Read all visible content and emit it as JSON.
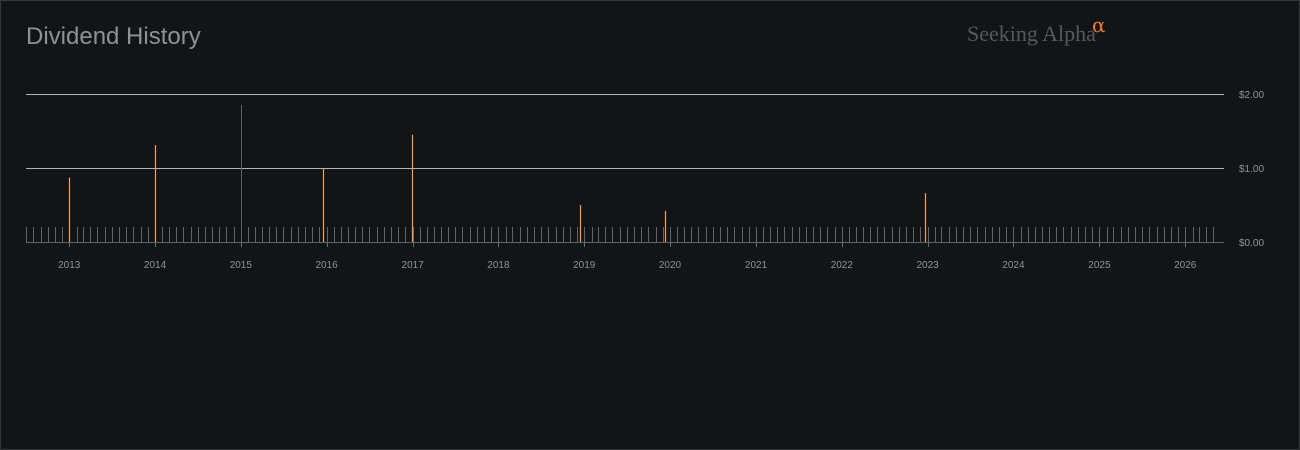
{
  "header": {
    "title": "Dividend History",
    "brand_name": "Seeking Alpha",
    "brand_mark": "α"
  },
  "colors": {
    "background": "#121518",
    "gridline": "#d0d0d0",
    "dividend_bar": "#f5a05a",
    "highlight_marker": "#5c6066",
    "minor_tick": "#6a6e73",
    "axis_text": "#8f9399",
    "brand_accent": "#f07b1e"
  },
  "chart_data": {
    "type": "bar",
    "title": "Dividend History",
    "xlabel": "",
    "ylabel": "",
    "xlim": [
      "2012-07-01",
      "2026-06-15"
    ],
    "ylim": [
      0,
      2
    ],
    "x_tick_labels": [
      "2013",
      "2014",
      "2015",
      "2016",
      "2017",
      "2018",
      "2019",
      "2020",
      "2021",
      "2022",
      "2023",
      "2024",
      "2025",
      "2026"
    ],
    "y_tick_labels": [
      "$0.00",
      "$1.00",
      "$2.00"
    ],
    "y_ticks": [
      0,
      1,
      2
    ],
    "grid": true,
    "series": [
      {
        "x": [
          "2013-01-01",
          "2014-01-01",
          "2015-12-15",
          "2016-12-31",
          "2018-12-15",
          "2019-12-10",
          "2022-12-20"
        ],
        "values": [
          0.87,
          1.31,
          0.99,
          1.45,
          0.5,
          0.42,
          0.66
        ]
      }
    ],
    "highlight_marker": {
      "x": "2015-01-01",
      "value": 1.85
    }
  }
}
